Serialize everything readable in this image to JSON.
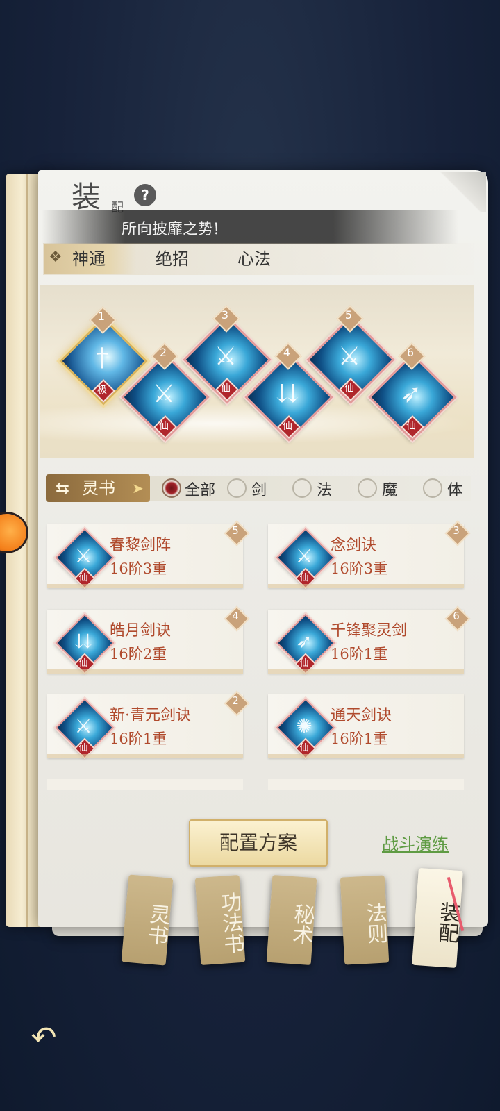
{
  "header": {
    "title_main": "装",
    "title_sub": "配",
    "banner_text": "所向披靡之势!"
  },
  "tabs": [
    {
      "label": "神通",
      "active": true
    },
    {
      "label": "绝招",
      "active": false
    },
    {
      "label": "心法",
      "active": false
    }
  ],
  "equipped": [
    {
      "slot": "1",
      "rank": "极"
    },
    {
      "slot": "2",
      "rank": "仙"
    },
    {
      "slot": "3",
      "rank": "仙"
    },
    {
      "slot": "4",
      "rank": "仙"
    },
    {
      "slot": "5",
      "rank": "仙"
    },
    {
      "slot": "6",
      "rank": "仙"
    }
  ],
  "filter": {
    "button_label": "灵书",
    "options": [
      {
        "label": "全部",
        "selected": true
      },
      {
        "label": "剑",
        "selected": false
      },
      {
        "label": "法",
        "selected": false
      },
      {
        "label": "魔",
        "selected": false
      },
      {
        "label": "体",
        "selected": false
      }
    ]
  },
  "skills": [
    {
      "name": "春黎剑阵",
      "level": "16阶3重",
      "rank": "仙",
      "slot": "5"
    },
    {
      "name": "念剑诀",
      "level": "16阶3重",
      "rank": "仙",
      "slot": "3"
    },
    {
      "name": "皓月剑诀",
      "level": "16阶2重",
      "rank": "仙",
      "slot": "4"
    },
    {
      "name": "千锋聚灵剑",
      "level": "16阶1重",
      "rank": "仙",
      "slot": "6"
    },
    {
      "name": "新·青元剑诀",
      "level": "16阶1重",
      "rank": "仙",
      "slot": "2"
    },
    {
      "name": "通天剑诀",
      "level": "16阶1重",
      "rank": "仙",
      "slot": ""
    }
  ],
  "actions": {
    "config_label": "配置方案",
    "drill_label": "战斗演练"
  },
  "bookmarks": [
    {
      "label": "灵书",
      "active": false
    },
    {
      "label": "功法书",
      "active": false
    },
    {
      "label": "秘术",
      "active": false
    },
    {
      "label": "法则",
      "active": false
    },
    {
      "label": "装配",
      "active": true
    }
  ],
  "icons": {
    "help": "help-icon",
    "back": "back-arrow-icon",
    "swap": "swap-arrows-icon"
  },
  "colors": {
    "skill_text": "#b04a2d",
    "rank_red": "#b0262c",
    "drill_green": "#5f9b43"
  }
}
